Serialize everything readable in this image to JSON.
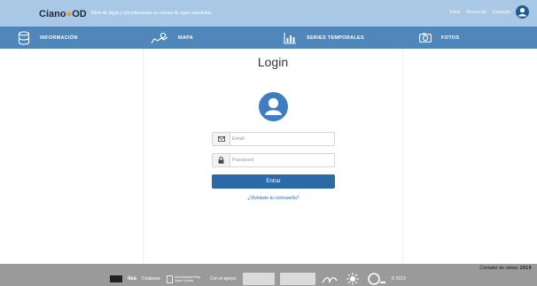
{
  "header": {
    "logo_main": "Ciano",
    "logo_accent": "●",
    "logo_tail": "OD",
    "tagline": "Nivel de algas y cianobacterias en masas de agua españolas",
    "links": [
      "Inicio",
      "Acerca de",
      "Contacto"
    ]
  },
  "nav": {
    "items": [
      {
        "label": "INFORMACIÓN",
        "icon": "database-icon"
      },
      {
        "label": "MAPA",
        "icon": "map-pin-icon"
      },
      {
        "label": "SERIES TEMPORALES",
        "icon": "chart-icon"
      },
      {
        "label": "FOTOS",
        "icon": "camera-icon"
      }
    ]
  },
  "login": {
    "title": "Login",
    "email_placeholder": "Email",
    "password_placeholder": "Password",
    "submit_label": "Entrar",
    "forgot_label": "¿Olvidaste tu contraseña?"
  },
  "footer": {
    "counter_label": "Contador de visitas:",
    "counter_value": "2919",
    "brand": "ilea",
    "collab_label": "Colabora:",
    "university": "Universidad Rey Juan Carlos",
    "support_label": "Con el apoyo:",
    "year": "© 2019"
  },
  "colors": {
    "topbar": "#a9c8e6",
    "navbar": "#4f87ba",
    "accent": "#2b6aa6",
    "footer": "#9a9a9a"
  }
}
